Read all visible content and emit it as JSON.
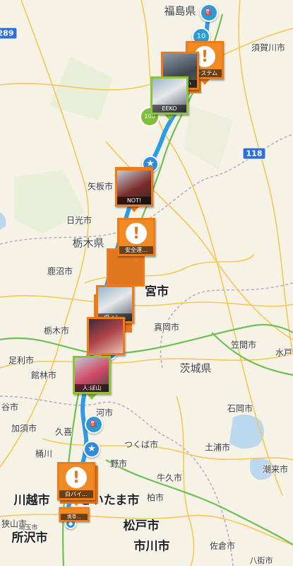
{
  "map": {
    "labels_big": [
      {
        "id": "saitama",
        "text": "さいたま市"
      },
      {
        "id": "kawagoe",
        "text": "川越市"
      },
      {
        "id": "tokorozawa",
        "text": "所沢市"
      },
      {
        "id": "matsudo",
        "text": "松戸市"
      },
      {
        "id": "ichikawa",
        "text": "市川市"
      },
      {
        "id": "utsunomiya",
        "text": "宮市"
      }
    ],
    "labels": [
      {
        "id": "fukushima",
        "text": "福島県"
      },
      {
        "id": "sukagawa",
        "text": "須賀川市"
      },
      {
        "id": "yaita",
        "text": "矢板市"
      },
      {
        "id": "nikko",
        "text": "日光市"
      },
      {
        "id": "tochigiken",
        "text": "栃木県"
      },
      {
        "id": "kanuma",
        "text": "鹿沼市"
      },
      {
        "id": "moka",
        "text": "真岡市"
      },
      {
        "id": "tochigi",
        "text": "栃木市"
      },
      {
        "id": "kasama",
        "text": "笠間市"
      },
      {
        "id": "mito",
        "text": "水戸"
      },
      {
        "id": "ashikaga",
        "text": "足利市"
      },
      {
        "id": "tatebayashi",
        "text": "館林市"
      },
      {
        "id": "ibarakiken",
        "text": "茨城県"
      },
      {
        "id": "koga",
        "text": "河市"
      },
      {
        "id": "ishioka",
        "text": "石岡市"
      },
      {
        "id": "yatani",
        "text": "谷市"
      },
      {
        "id": "kazo",
        "text": "加須市"
      },
      {
        "id": "kuki",
        "text": "久喜"
      },
      {
        "id": "okegawa",
        "text": "桶川"
      },
      {
        "id": "tsukuba",
        "text": "つくば市"
      },
      {
        "id": "tsuchiura",
        "text": "土浦市"
      },
      {
        "id": "ushiku",
        "text": "牛久市"
      },
      {
        "id": "kashiwa",
        "text": "柏市"
      },
      {
        "id": "itako",
        "text": "潮来市"
      },
      {
        "id": "sayama",
        "text": "狭山市"
      },
      {
        "id": "sakura",
        "text": "佐倉市"
      },
      {
        "id": "yachiyo",
        "text": "八街市"
      },
      {
        "id": "noda",
        "text": "野市"
      },
      {
        "id": "tokorozawa2",
        "text": "埼玉市"
      }
    ],
    "shields": [
      {
        "id": "r118",
        "text": "118"
      },
      {
        "id": "r289",
        "text": "289"
      }
    ]
  },
  "pins": [
    {
      "id": "pin-lsystem",
      "caption": "Lシステム",
      "kind": "warn"
    },
    {
      "id": "pin-sanmai",
      "caption": "さんまい",
      "kind": "photo"
    },
    {
      "id": "pin-ekko",
      "caption": "EEKO",
      "kind": "green"
    },
    {
      "id": "pin-not",
      "caption": "NOT!",
      "kind": "photo"
    },
    {
      "id": "pin-anzen",
      "caption": "安全運…",
      "kind": "warn"
    },
    {
      "id": "pin-vireo",
      "caption": "ヴィレ…",
      "kind": "photo"
    },
    {
      "id": "pin-hitomi",
      "caption": "",
      "kind": "photo"
    },
    {
      "id": "pin-hissan",
      "caption": "人:ぼ山",
      "kind": "green"
    },
    {
      "id": "pin-shirohai",
      "caption": "白バイ…",
      "kind": "warn"
    },
    {
      "id": "pin-keitai",
      "caption": "携帯…",
      "kind": "warn"
    }
  ],
  "badges": {
    "top_count": "10",
    "mid_count": "100"
  },
  "colors": {
    "route": "#2e9be6",
    "pin_orange": "#ef7a1a",
    "pin_green": "#8fc23a",
    "land": "#f5f1e6",
    "water": "#bcd8ee"
  }
}
